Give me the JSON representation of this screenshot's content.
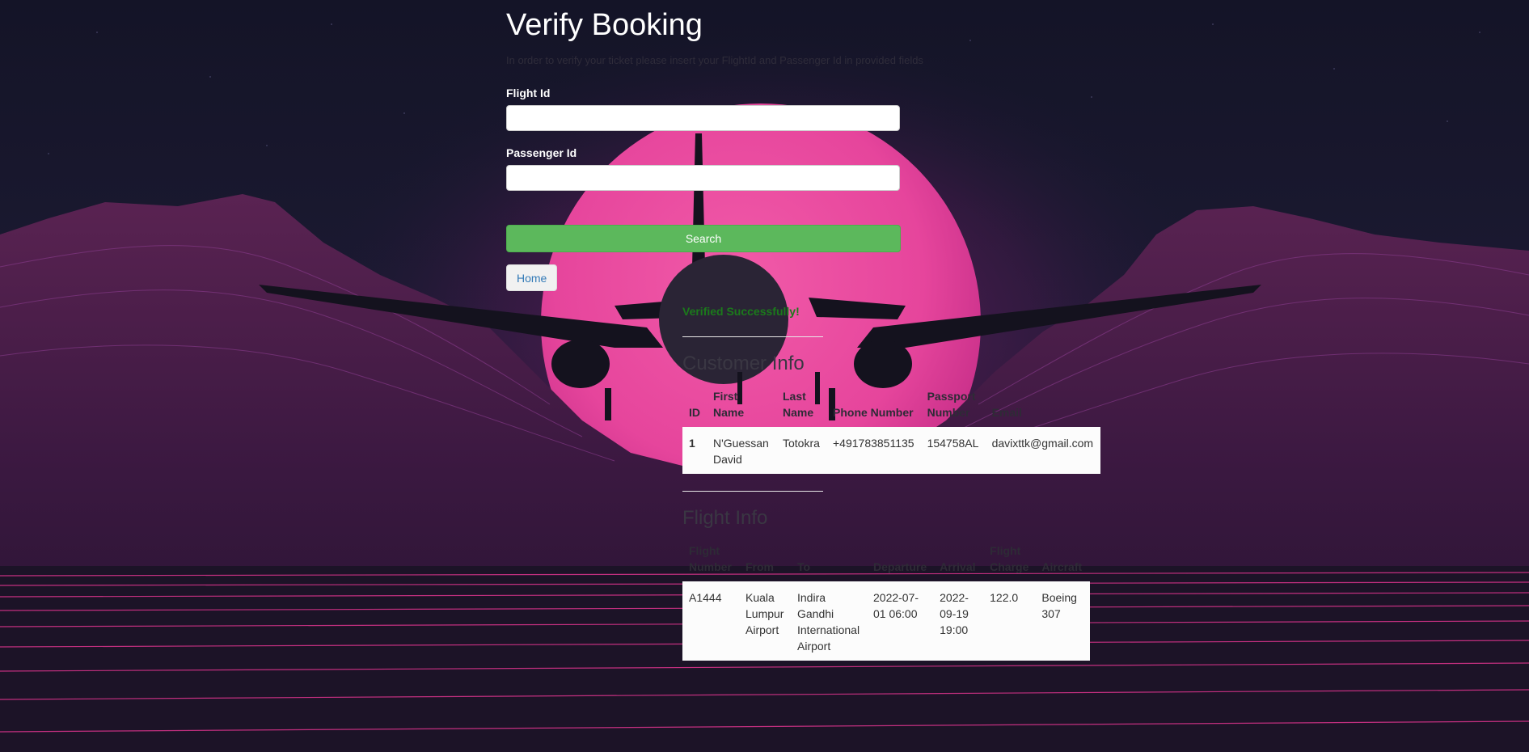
{
  "page": {
    "title": "Verify Booking",
    "subtitle": "In order to verify your ticket please insert your FlightId and Passenger Id in provided fields"
  },
  "form": {
    "flight_id_label": "Flight Id",
    "flight_id_value": "",
    "passenger_id_label": "Passenger Id",
    "passenger_id_value": "",
    "search_label": "Search",
    "home_label": "Home"
  },
  "status": {
    "message": "Verified Successfully!"
  },
  "customer": {
    "title": "Customer Info",
    "headers": [
      "ID",
      "First Name",
      "Last Name",
      "Phone Number",
      "Passport Number",
      "Email"
    ],
    "rows": [
      [
        "1",
        "N'Guessan David",
        "Totokra",
        "+491783851135",
        "154758AL",
        "davixttk@gmail.com"
      ]
    ]
  },
  "flight": {
    "title": "Flight Info",
    "headers": [
      "Flight Number",
      "From",
      "To",
      "Departure",
      "Arrival",
      "Flight Charge",
      "Aircraft"
    ],
    "rows": [
      [
        "A1444",
        "Kuala Lumpur Airport",
        "Indira Gandhi International Airport",
        "2022-07-01 06:00",
        "2022-09-19 19:00",
        "122.0",
        "Boeing 307"
      ]
    ]
  },
  "colors": {
    "search_button": "#5cb85c",
    "verified_text": "#1b7a1b",
    "moon": "#e64aa0",
    "background": "#171628"
  }
}
